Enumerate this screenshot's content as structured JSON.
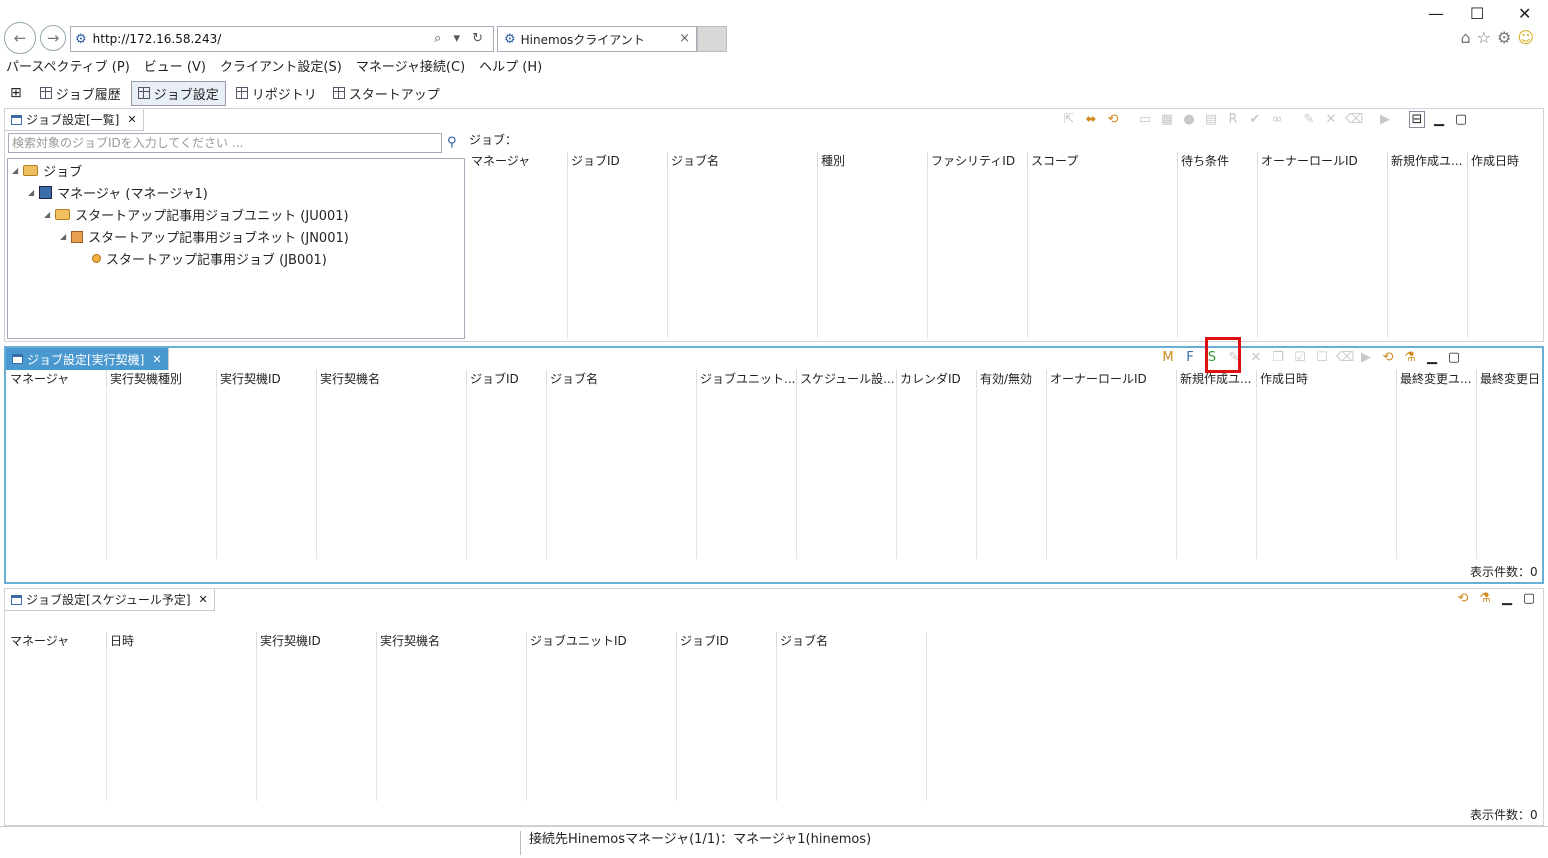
{
  "browser": {
    "url": "http://172.16.58.243/",
    "tab_title": "Hinemosクライアント",
    "tab_close": "×",
    "window_controls": [
      "—",
      "☐",
      "✕"
    ],
    "address_controls": "⌕ ▾ ↻"
  },
  "menu": [
    "パースペクティブ (P)",
    "ビュー (V)",
    "クライアント設定(S)",
    "マネージャ接続(C)",
    "ヘルプ (H)"
  ],
  "perspectives": [
    {
      "label": "ジョブ履歴",
      "selected": false
    },
    {
      "label": "ジョブ設定",
      "selected": true
    },
    {
      "label": "リポジトリ",
      "selected": false
    },
    {
      "label": "スタートアップ",
      "selected": false
    }
  ],
  "job_list": {
    "tab_title": "ジョブ設定[一覧]",
    "search_placeholder": "検索対象のジョブIDを入力してください ...",
    "job_label": "ジョブ：",
    "tree": [
      {
        "label": "ジョブ",
        "level": 0,
        "icon": "folder-icon"
      },
      {
        "label": "マネージャ (マネージャ1)",
        "level": 1,
        "icon": "manager-icon"
      },
      {
        "label": "スタートアップ記事用ジョブユニット (JU001)",
        "level": 2,
        "icon": "folder-icon"
      },
      {
        "label": "スタートアップ記事用ジョブネット (JN001)",
        "level": 3,
        "icon": "jobnet-icon"
      },
      {
        "label": "スタートアップ記事用ジョブ (JB001)",
        "level": 4,
        "icon": "job-icon"
      }
    ],
    "columns": [
      "マネージャ",
      "ジョブID",
      "ジョブ名",
      "種別",
      "ファシリティID",
      "スコープ",
      "待ち条件",
      "オーナーロールID",
      "新規作成ユ...",
      "作成日時"
    ]
  },
  "kick": {
    "tab_title": "ジョブ設定[実行契機]",
    "columns": [
      "マネージャ",
      "実行契機種別",
      "実行契機ID",
      "実行契機名",
      "ジョブID",
      "ジョブ名",
      "ジョブユニット...",
      "スケジュール設...",
      "カレンダID",
      "有効/無効",
      "オーナーロールID",
      "新規作成ユ...",
      "作成日時",
      "最終変更ユ...",
      "最終変更日"
    ],
    "count": "表示件数：0"
  },
  "schedule": {
    "tab_title": "ジョブ設定[スケジュール予定]",
    "columns": [
      "マネージャ",
      "日時",
      "実行契機ID",
      "実行契機名",
      "ジョブユニットID",
      "ジョブID",
      "ジョブ名"
    ],
    "count": "表示件数：0"
  },
  "status": {
    "text": "接続先Hinemosマネージャ(1/1)：マネージャ1(hinemos)"
  },
  "colors": {
    "accent": "#4a98d0",
    "highlight": "#e01010"
  }
}
